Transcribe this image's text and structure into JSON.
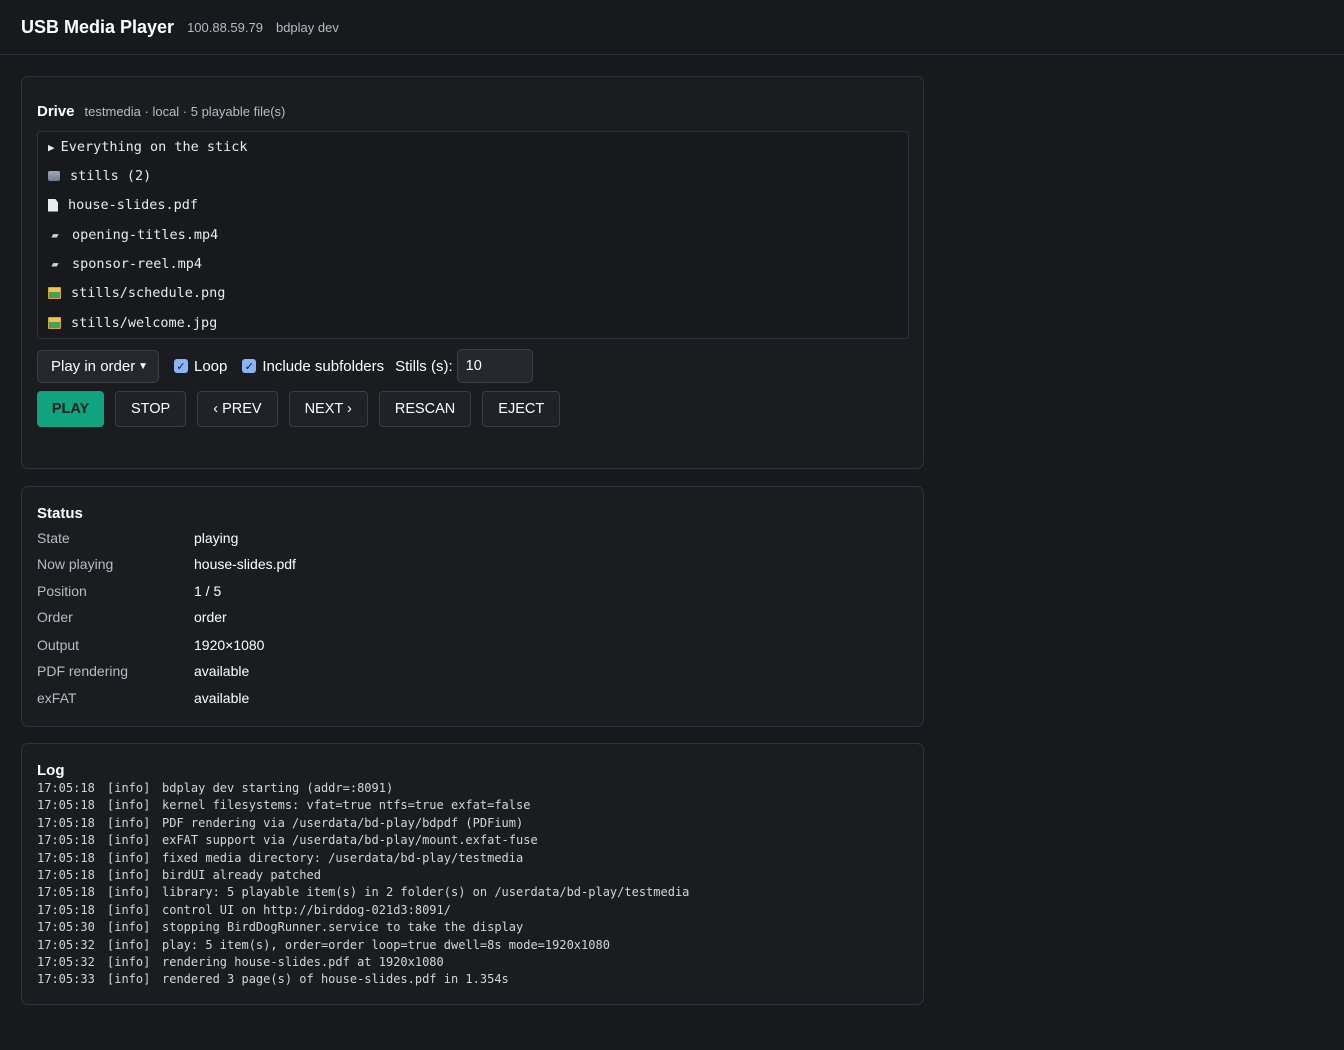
{
  "header": {
    "title": "USB Media Player",
    "host": "100.88.59.79",
    "build": "bdplay dev"
  },
  "drive": {
    "title": "Drive",
    "meta": "testmedia · local · 5 playable file(s)",
    "tree_summary": "Everything on the stick",
    "files": [
      {
        "icon": "folder-icon",
        "name": "stills (2)"
      },
      {
        "icon": "document-icon",
        "name": "house-slides.pdf"
      },
      {
        "icon": "clapperboard-icon",
        "name": "opening-titles.mp4"
      },
      {
        "icon": "clapperboard-icon",
        "name": "sponsor-reel.mp4"
      },
      {
        "icon": "image-icon",
        "name": "stills/schedule.png"
      },
      {
        "icon": "image-icon",
        "name": "stills/welcome.jpg"
      }
    ],
    "controls": {
      "order_select": "Play in order",
      "loop_label": "Loop",
      "loop_checked": true,
      "subfolders_label": "Include subfolders",
      "subfolders_checked": true,
      "stills_label": "Stills (s):",
      "stills_value": "10"
    },
    "buttons": {
      "play": "PLAY",
      "stop": "STOP",
      "prev": "‹ PREV",
      "next": "NEXT ›",
      "rescan": "RESCAN",
      "eject": "EJECT"
    },
    "accent_color": "#10a37f"
  },
  "status": {
    "title": "Status",
    "rows": [
      {
        "key": "State",
        "value": "playing"
      },
      {
        "key": "Now playing",
        "value": "house-slides.pdf"
      },
      {
        "key": "Position",
        "value": "1 / 5"
      },
      {
        "key": "Order",
        "value": "order"
      },
      {
        "key": "Output",
        "value": "1920×1080"
      },
      {
        "key": "PDF rendering",
        "value": "available"
      },
      {
        "key": "exFAT",
        "value": "available"
      }
    ]
  },
  "log": {
    "title": "Log",
    "lines": [
      {
        "time": "17:05:18",
        "level": "[info]",
        "msg": "bdplay dev starting (addr=:8091)"
      },
      {
        "time": "17:05:18",
        "level": "[info]",
        "msg": "kernel filesystems: vfat=true ntfs=true exfat=false"
      },
      {
        "time": "17:05:18",
        "level": "[info]",
        "msg": "PDF rendering via /userdata/bd-play/bdpdf (PDFium)"
      },
      {
        "time": "17:05:18",
        "level": "[info]",
        "msg": "exFAT support via /userdata/bd-play/mount.exfat-fuse"
      },
      {
        "time": "17:05:18",
        "level": "[info]",
        "msg": "fixed media directory: /userdata/bd-play/testmedia"
      },
      {
        "time": "17:05:18",
        "level": "[info]",
        "msg": "birdUI already patched"
      },
      {
        "time": "17:05:18",
        "level": "[info]",
        "msg": "library: 5 playable item(s) in 2 folder(s) on /userdata/bd-play/testmedia"
      },
      {
        "time": "17:05:18",
        "level": "[info]",
        "msg": "control UI on http://birddog-021d3:8091/"
      },
      {
        "time": "17:05:30",
        "level": "[info]",
        "msg": "stopping BirdDogRunner.service to take the display"
      },
      {
        "time": "17:05:32",
        "level": "[info]",
        "msg": "play: 5 item(s), order=order loop=true dwell=8s mode=1920x1080"
      },
      {
        "time": "17:05:32",
        "level": "[info]",
        "msg": "rendering house-slides.pdf at 1920x1080"
      },
      {
        "time": "17:05:33",
        "level": "[info]",
        "msg": "rendered 3 page(s) of house-slides.pdf in 1.354s"
      }
    ]
  }
}
